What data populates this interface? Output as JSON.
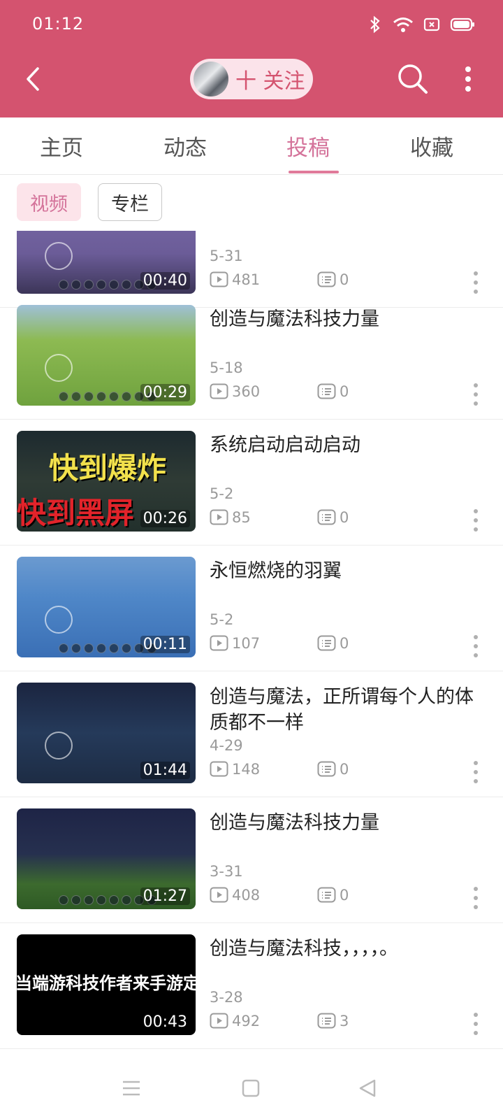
{
  "status_bar": {
    "time": "01:12"
  },
  "header": {
    "follow_label": "十 关注"
  },
  "tabs": [
    {
      "label": "主页"
    },
    {
      "label": "动态"
    },
    {
      "label": "投稿"
    },
    {
      "label": "收藏"
    }
  ],
  "active_tab": "投稿",
  "subtabs": {
    "video": "视频",
    "column": "专栏"
  },
  "thumb_text": {
    "overlay_1": "快到爆炸",
    "overlay_2": "快到黑屏",
    "overlay_3": "当端游科技作者来手游定怪"
  },
  "videos": [
    {
      "title": "",
      "date": "5-31",
      "plays": "481",
      "comments": "0",
      "duration": "00:40"
    },
    {
      "title": "创造与魔法科技力量",
      "date": "5-18",
      "plays": "360",
      "comments": "0",
      "duration": "00:29"
    },
    {
      "title": "系统启动启动启动",
      "date": "5-2",
      "plays": "85",
      "comments": "0",
      "duration": "00:26"
    },
    {
      "title": "永恒燃烧的羽翼",
      "date": "5-2",
      "plays": "107",
      "comments": "0",
      "duration": "00:11"
    },
    {
      "title": "创造与魔法，正所谓每个人的体质都不一样",
      "date": "4-29",
      "plays": "148",
      "comments": "0",
      "duration": "01:44"
    },
    {
      "title": "创造与魔法科技力量",
      "date": "3-31",
      "plays": "408",
      "comments": "0",
      "duration": "01:27"
    },
    {
      "title": "创造与魔法科技，，，，。",
      "date": "3-28",
      "plays": "492",
      "comments": "3",
      "duration": "00:43"
    }
  ],
  "colors": {
    "brand": "#d4536f",
    "accent": "#d4739a"
  },
  "icons": [
    "back-icon",
    "search-icon",
    "more-icon",
    "play-icon",
    "comment-icon",
    "kebab-icon",
    "menu-icon",
    "home-icon",
    "back-nav-icon"
  ]
}
